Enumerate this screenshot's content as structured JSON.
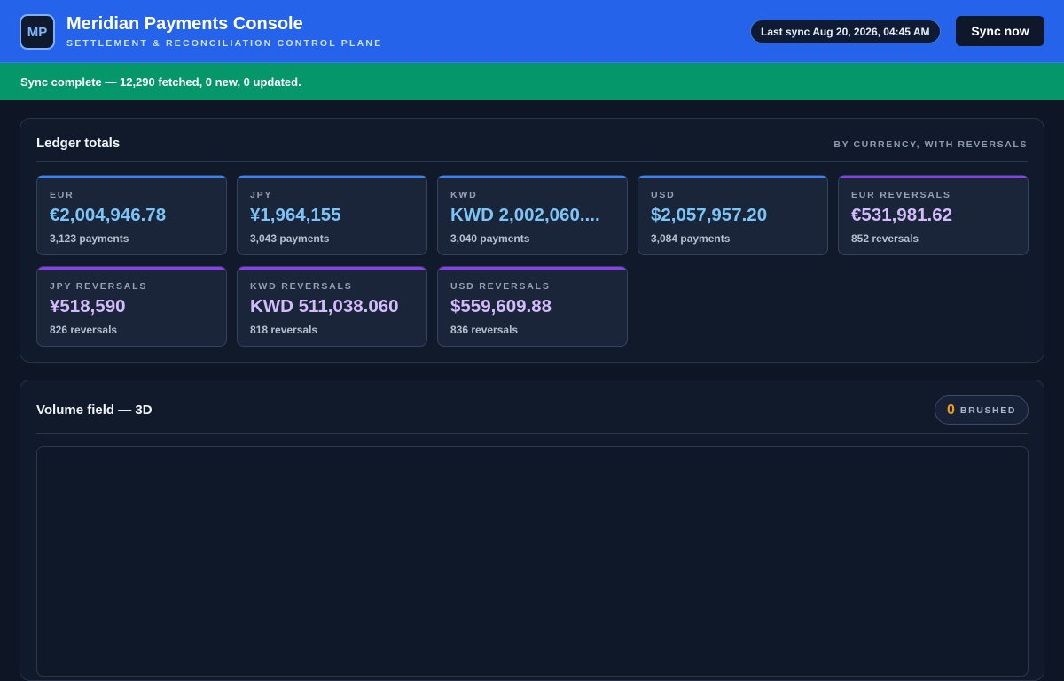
{
  "header": {
    "logo_text": "MP",
    "title": "Meridian Payments Console",
    "subtitle": "SETTLEMENT & RECONCILIATION CONTROL PLANE",
    "last_sync": "Last sync Aug 20, 2026, 04:45 AM",
    "sync_button": "Sync now"
  },
  "banner": {
    "message": "Sync complete — 12,290 fetched, 0 new, 0 updated."
  },
  "ledger": {
    "title": "Ledger totals",
    "meta": "BY CURRENCY, WITH REVERSALS",
    "cards": [
      {
        "label": "EUR",
        "value": "€2,004,946.78",
        "count": "3,123 payments",
        "kind": "currency"
      },
      {
        "label": "JPY",
        "value": "¥1,964,155",
        "count": "3,043 payments",
        "kind": "currency"
      },
      {
        "label": "KWD",
        "value": "KWD 2,002,060....",
        "count": "3,040 payments",
        "kind": "currency"
      },
      {
        "label": "USD",
        "value": "$2,057,957.20",
        "count": "3,084 payments",
        "kind": "currency"
      },
      {
        "label": "EUR REVERSALS",
        "value": "€531,981.62",
        "count": "852 reversals",
        "kind": "reversal"
      },
      {
        "label": "JPY REVERSALS",
        "value": "¥518,590",
        "count": "826 reversals",
        "kind": "reversal"
      },
      {
        "label": "KWD REVERSALS",
        "value": "KWD 511,038.060",
        "count": "818 reversals",
        "kind": "reversal"
      },
      {
        "label": "USD REVERSALS",
        "value": "$559,609.88",
        "count": "836 reversals",
        "kind": "reversal"
      }
    ]
  },
  "volume": {
    "title": "Volume field — 3D",
    "brushed_count": "0",
    "brushed_label": "BRUSHED"
  },
  "colors": {
    "header_bg": "#2563eb",
    "banner_success": "#059669",
    "currency_accent": "#3b82f6",
    "reversal_accent": "#8b3fe8",
    "brushed_accent": "#f59e0b"
  }
}
